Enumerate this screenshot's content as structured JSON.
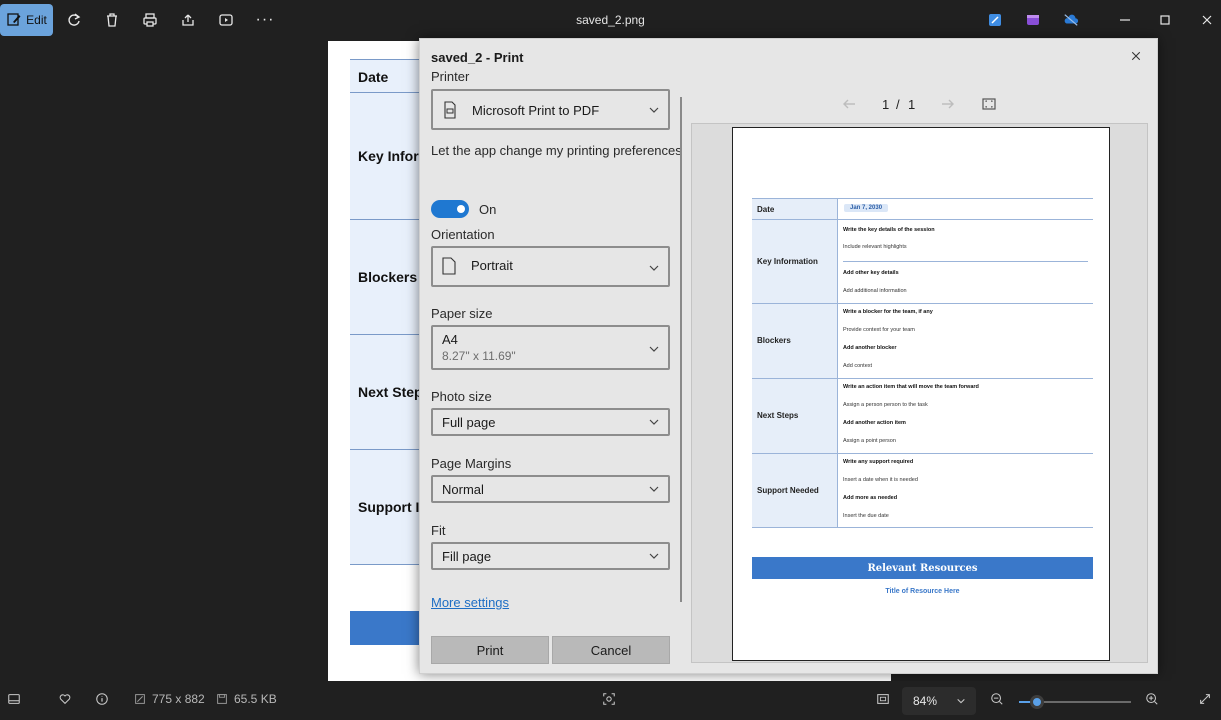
{
  "app": {
    "window_title": "saved_2.png",
    "toolbar": {
      "edit_label": "Edit"
    },
    "colors": {
      "accent": "#5aa0e8",
      "edit_button": "#6ba3dc",
      "doc_blue": "#3a78c9"
    }
  },
  "background_document": {
    "rows": [
      "Date",
      "Key Infor",
      "Blockers",
      "Next Step",
      "Support I"
    ]
  },
  "print_dialog": {
    "title": "saved_2 - Print",
    "printer": {
      "label": "Printer",
      "value": "Microsoft Print to PDF"
    },
    "preferences": {
      "label": "Let the app change my printing preferences",
      "toggle_state": "On"
    },
    "orientation": {
      "label": "Orientation",
      "value": "Portrait"
    },
    "paper_size": {
      "label": "Paper size",
      "value": "A4",
      "sub": "8.27\" x 11.69\""
    },
    "photo_size": {
      "label": "Photo size",
      "value": "Full page"
    },
    "page_margins": {
      "label": "Page Margins",
      "value": "Normal"
    },
    "fit": {
      "label": "Fit",
      "value": "Fill page"
    },
    "more_settings": "More settings",
    "print_button": "Print",
    "cancel_button": "Cancel",
    "preview_nav": {
      "current_page": "1",
      "separator": "/",
      "total_pages": "1"
    }
  },
  "preview_page": {
    "date_label": "Date",
    "date_value": "Jan 7, 2030",
    "key_info": {
      "label": "Key Information",
      "lines": [
        "Write the key details of the session",
        "Include relevant highlights",
        "Add other key details",
        "Add additional information"
      ]
    },
    "blockers": {
      "label": "Blockers",
      "lines": [
        "Write a blocker for the team, if any",
        "Provide context for your team",
        "Add another blocker",
        "Add context"
      ]
    },
    "next_steps": {
      "label": "Next Steps",
      "lines": [
        "Write an action item that will move the team forward",
        "Assign a person person to the task",
        "Add another action item",
        "Assign a point person"
      ]
    },
    "support": {
      "label": "Support Needed",
      "lines": [
        "Write any support required",
        "Insert a date when it is needed",
        "Add more as needed",
        "Insert the due date"
      ]
    },
    "banner": "Relevant Resources",
    "link": "Title of Resource Here"
  },
  "status_bar": {
    "dimensions": "775 x 882",
    "file_size": "65.5 KB",
    "zoom": "84%",
    "zoom_level": 0.16
  }
}
